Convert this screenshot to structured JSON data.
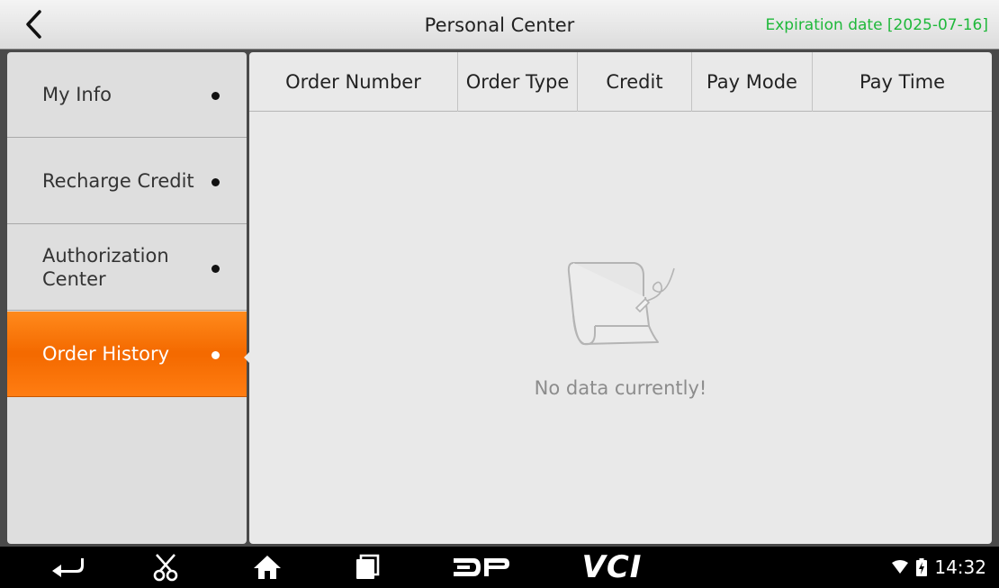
{
  "header": {
    "title": "Personal Center",
    "expiration": "Expiration date [2025-07-16]",
    "back_icon": "chevron-left-icon"
  },
  "sidebar": {
    "items": [
      {
        "label": "My Info",
        "active": false
      },
      {
        "label": "Recharge Credit",
        "active": false
      },
      {
        "label": "Authorization Center",
        "active": false
      },
      {
        "label": "Order History",
        "active": true
      }
    ]
  },
  "table": {
    "columns": [
      "Order Number",
      "Order Type",
      "Credit",
      "Pay Mode",
      "Pay Time"
    ],
    "empty_text": "No data currently!"
  },
  "navbar": {
    "icons": [
      "back-arrow-icon",
      "scissors-icon",
      "home-icon",
      "recent-apps-icon",
      "dp-logo-icon",
      "vci-icon"
    ],
    "vci_label": "VCI",
    "time": "14:32"
  },
  "colors": {
    "accent": "#f46a00",
    "expiration": "#1fb83a"
  }
}
